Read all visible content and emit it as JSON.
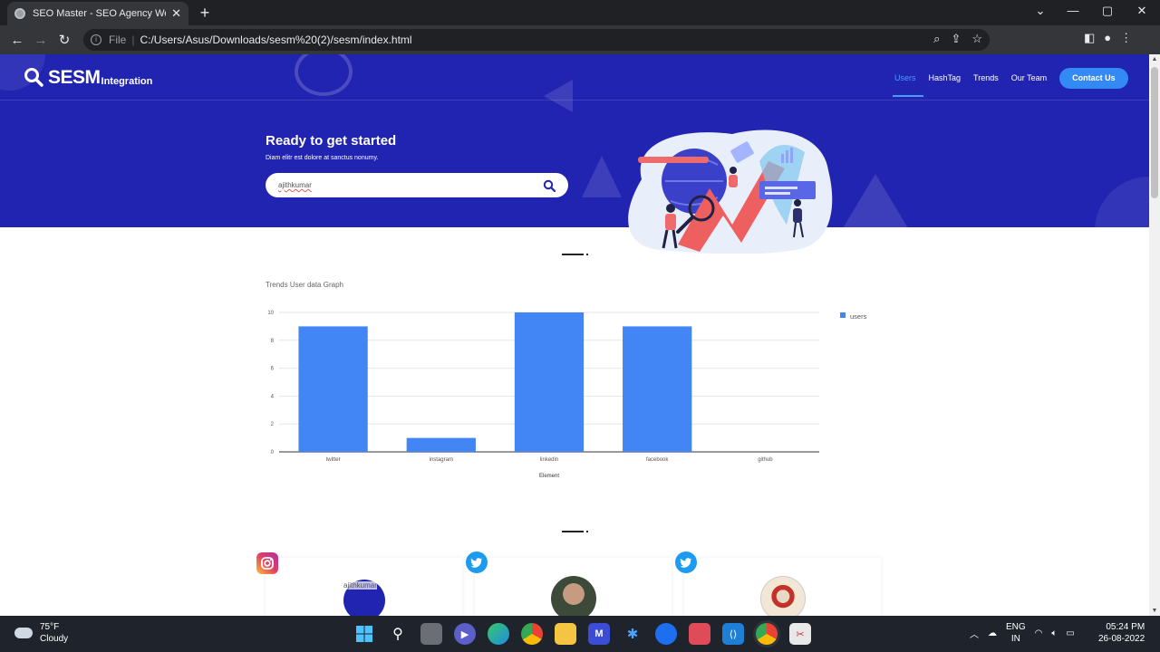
{
  "browser": {
    "tab_title": "SEO Master - SEO Agency Websi",
    "url_scheme": "File",
    "url": "C:/Users/Asus/Downloads/sesm%20(2)/sesm/index.html"
  },
  "site": {
    "brand": "SESM",
    "brand_sub": "Integration",
    "nav": [
      {
        "label": "Users",
        "active": true
      },
      {
        "label": "HashTag"
      },
      {
        "label": "Trends"
      },
      {
        "label": "Our Team"
      }
    ],
    "contact_label": "Contact Us",
    "hero_title": "Ready to get started",
    "hero_sub": "Diam elitr est dolore at sanctus nonumy.",
    "search_value": "ajithkumar"
  },
  "chart_title": "Trends User data Graph",
  "chart_data": {
    "type": "bar",
    "title": "Trends User data Graph",
    "categories": [
      "twitter",
      "instagram",
      "linkedin",
      "facebook",
      "github"
    ],
    "series": [
      {
        "name": "users",
        "values": [
          9,
          1,
          10,
          9,
          0
        ]
      }
    ],
    "xlabel": "Element",
    "ylabel": "",
    "ylim": [
      0,
      10
    ],
    "yticks": [
      0,
      2,
      4,
      6,
      8,
      10
    ],
    "grid": true,
    "legend": "top-right",
    "color": "#4285f4"
  },
  "cards": [
    {
      "platform": "instagram-icon",
      "avatar_alt": "ajithkumar"
    },
    {
      "platform": "twitter-icon",
      "avatar_alt": ""
    },
    {
      "platform": "twitter-icon",
      "avatar_alt": ""
    }
  ],
  "taskbar": {
    "temp": "75°F",
    "weather": "Cloudy",
    "lang1": "ENG",
    "lang2": "IN",
    "time": "05:24 PM",
    "date": "26-08-2022"
  },
  "colors": {
    "hero_bg": "#2124b1",
    "accent": "#348af5",
    "bar": "#4285f4"
  }
}
